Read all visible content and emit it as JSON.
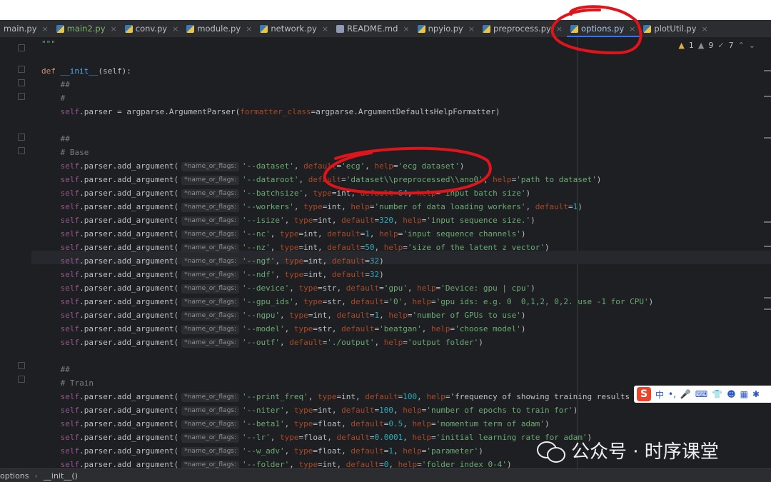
{
  "tabs": [
    {
      "label": "main.py",
      "active": false,
      "icon": "python-file-icon"
    },
    {
      "label": "main2.py",
      "active": false,
      "icon": "python-file-icon"
    },
    {
      "label": "conv.py",
      "active": false,
      "icon": "python-file-icon"
    },
    {
      "label": "module.py",
      "active": false,
      "icon": "python-file-icon"
    },
    {
      "label": "network.py",
      "active": false,
      "icon": "python-file-icon"
    },
    {
      "label": "README.md",
      "active": false,
      "icon": "markdown-file-icon"
    },
    {
      "label": "npyio.py",
      "active": false,
      "icon": "python-file-icon"
    },
    {
      "label": "preprocess.py",
      "active": false,
      "icon": "python-file-icon"
    },
    {
      "label": "options.py",
      "active": true,
      "icon": "python-file-icon"
    },
    {
      "label": "plotUtil.py",
      "active": false,
      "icon": "python-file-icon"
    }
  ],
  "tab_close_glyph": "×",
  "inspections": {
    "warnings": "1",
    "weak_warnings": "9",
    "typos": "7"
  },
  "param_hint": "*name_or_flags:",
  "code": {
    "l0": "\"\"\"",
    "def_kw": "def",
    "def_name": "__init__",
    "def_tail": "(self):",
    "c1": "##",
    "c2": "#",
    "parser_pre": ".parser = argparse.ArgumentParser(",
    "parser_kw": "formatter_class",
    "parser_post": "=argparse.ArgumentDefaultsHelpFormatter)",
    "c3": "##",
    "c4": "# Base",
    "c5": "##",
    "c6": "# Train",
    "self": "self",
    "call": ".parser.add_argument(",
    "args": [
      "'--dataset', default='ecg', help='ecg dataset')",
      "'--dataroot', default='dataset\\\\preprocessed\\\\ano0', help='path to dataset')",
      "'--batchsize', type=int, default=64, help='input batch size')",
      "'--workers', type=int, help='number of data loading workers', default=1)",
      "'--isize', type=int, default=320, help='input sequence size.')",
      "'--nc', type=int, default=1, help='input sequence channels')",
      "'--nz', type=int, default=50, help='size of the latent z vector')",
      "'--ngf', type=int, default=32)",
      "'--ndf', type=int, default=32)",
      "'--device', type=str, default='gpu', help='Device: gpu | cpu')",
      "'--gpu_ids', type=str, default='0', help='gpu ids: e.g. 0  0,1,2, 0,2. use -1 for CPU')",
      "'--ngpu', type=int, default=1, help='number of GPUs to use')",
      "'--model', type=str, default='beatgan', help='choose model')",
      "'--outf', default='./output', help='output folder')",
      "'--print_freq', type=int, default=100, help='frequency of showing training results on c",
      "'--niter', type=int, default=100, help='number of epochs to train for')",
      "'--beta1', type=float, default=0.5, help='momentum term of adam')",
      "'--lr', type=float, default=0.0001, help='initial learning rate for adam')",
      "'--w_adv', type=float, default=1, help='parameter')",
      "'--folder', type=int, default=0, help='folder index 0-4')"
    ]
  },
  "breadcrumb": {
    "file": "options",
    "sep": "›",
    "method": "__init__()"
  },
  "ime": {
    "logo": "S",
    "lang": "中",
    "punct": "•,",
    "mic": "🎤",
    "keyboard": "⌨",
    "shirt": "👕",
    "chat": "☻",
    "grid": "▦",
    "more": "✱"
  },
  "watermark": {
    "text": "公众号 · 时序课堂"
  },
  "colors": {
    "annotation_red": "#e0141b",
    "accent": "#3574f0"
  }
}
